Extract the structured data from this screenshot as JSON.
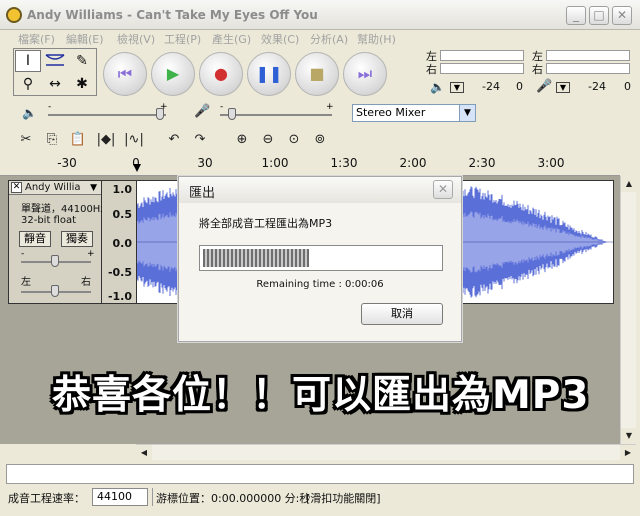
{
  "window": {
    "title": "Andy Williams  - Can't Take My Eyes Off You",
    "minimize": "_",
    "maximize": "□",
    "close": "✕"
  },
  "menu": [
    "檔案(F)",
    "編輯(E)",
    "檢視(V)",
    "工程(P)",
    "產生(G)",
    "效果(C)",
    "分析(A)",
    "幫助(H)"
  ],
  "meters": {
    "play_left": "左",
    "play_right": "右",
    "rec_left": "左",
    "rec_right": "右",
    "play_scale": [
      "-24",
      "0"
    ],
    "rec_scale": [
      "-24",
      "0"
    ]
  },
  "mixer": {
    "input_source": "Stereo Mixer",
    "minus": "-",
    "plus": "+"
  },
  "ruler": {
    "ticks": [
      "-30",
      "0",
      "30",
      "1:00",
      "1:30",
      "2:00",
      "2:30",
      "3:00"
    ]
  },
  "track": {
    "name": "Andy Willia",
    "channel": "單聲道，44100Hz",
    "format": "32-bit float",
    "mute": "靜音",
    "solo": "獨奏",
    "pan_left": "左",
    "pan_right": "右",
    "gain_minus": "-",
    "gain_plus": "+",
    "scale": [
      "1.0",
      "0.5",
      "0.0",
      "-0.5",
      "-1.0"
    ]
  },
  "dialog": {
    "title": "匯出",
    "message": "將全部成音工程匯出為MP3",
    "progress": 0.45,
    "remaining": "Remaining time : 0:00:06",
    "cancel": "取消"
  },
  "caption": "恭喜各位！！可以匯出為MP3",
  "status": {
    "rate_label": "成音工程速率：",
    "rate_value": "44100",
    "cursor": "游標位置：0:00.000000 分:秒",
    "snap": "[滑扣功能關閉]"
  },
  "colors": {
    "waveform": "#5b6fd8",
    "waveform_light": "#98a4e8",
    "play_green": "#3fb34a",
    "record_red": "#d23030",
    "pause_blue": "#2e5fd4",
    "stop_olive": "#b9a766",
    "skip_purple": "#8a6fd8"
  }
}
